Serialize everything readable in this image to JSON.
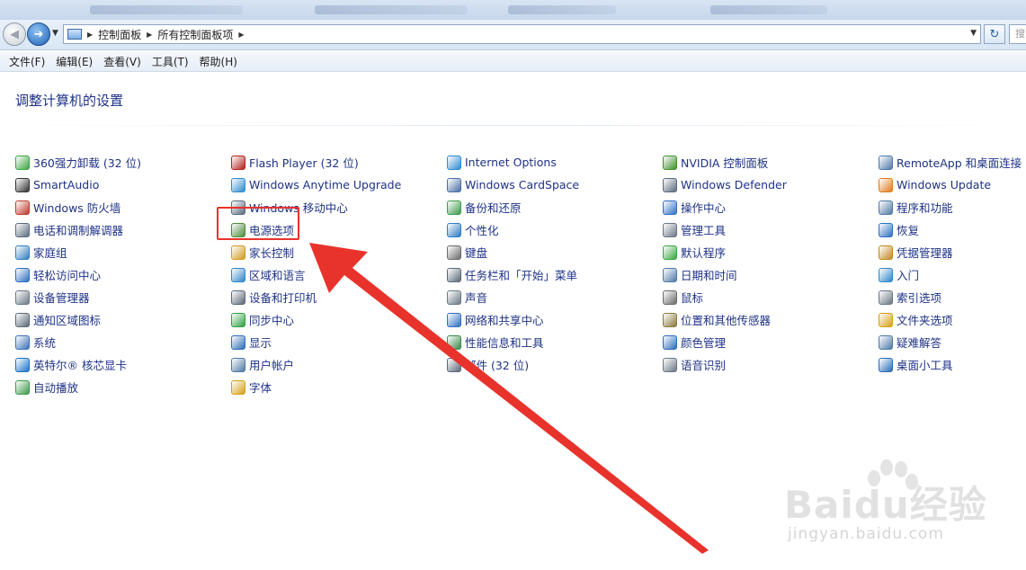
{
  "address_bar": {
    "breadcrumbs": [
      "控制面板",
      "所有控制面板项"
    ]
  },
  "search_placeholder": "搜",
  "menu": [
    "文件(F)",
    "编辑(E)",
    "查看(V)",
    "工具(T)",
    "帮助(H)"
  ],
  "page_title": "调整计算机的设置",
  "columns": [
    [
      {
        "label": "360强力卸载 (32 位)",
        "icon": "uninstall-icon",
        "color": "#3aa542"
      },
      {
        "label": "SmartAudio",
        "icon": "headphones-icon",
        "color": "#333333"
      },
      {
        "label": "Windows 防火墙",
        "icon": "firewall-icon",
        "color": "#c0392b"
      },
      {
        "label": "电话和调制解调器",
        "icon": "phone-modem-icon",
        "color": "#5a6b7d"
      },
      {
        "label": "家庭组",
        "icon": "homegroup-icon",
        "color": "#2f7fc1"
      },
      {
        "label": "轻松访问中心",
        "icon": "ease-of-access-icon",
        "color": "#2f6fc1"
      },
      {
        "label": "设备管理器",
        "icon": "device-manager-icon",
        "color": "#6b7785"
      },
      {
        "label": "通知区域图标",
        "icon": "notification-icons-icon",
        "color": "#5b6878"
      },
      {
        "label": "系统",
        "icon": "system-icon",
        "color": "#3b71b8"
      },
      {
        "label": "英特尔® 核芯显卡",
        "icon": "intel-graphics-icon",
        "color": "#1a73c7"
      },
      {
        "label": "自动播放",
        "icon": "autoplay-icon",
        "color": "#3a9a4a"
      }
    ],
    [
      {
        "label": "Flash Player (32 位)",
        "icon": "flash-player-icon",
        "color": "#b3221c"
      },
      {
        "label": "Windows Anytime Upgrade",
        "icon": "windows-upgrade-icon",
        "color": "#2c8ad0"
      },
      {
        "label": "Windows 移动中心",
        "icon": "mobility-center-icon",
        "color": "#5a6b7d"
      },
      {
        "label": "电源选项",
        "icon": "power-options-icon",
        "color": "#4a8a3a"
      },
      {
        "label": "家长控制",
        "icon": "parental-controls-icon",
        "color": "#d19a1f"
      },
      {
        "label": "区域和语言",
        "icon": "region-language-icon",
        "color": "#2f86c9"
      },
      {
        "label": "设备和打印机",
        "icon": "printer-icon",
        "color": "#5b6878"
      },
      {
        "label": "同步中心",
        "icon": "sync-center-icon",
        "color": "#2ea043"
      },
      {
        "label": "显示",
        "icon": "display-icon",
        "color": "#2b6cb8"
      },
      {
        "label": "用户帐户",
        "icon": "user-accounts-icon",
        "color": "#4f7aa8"
      },
      {
        "label": "字体",
        "icon": "fonts-icon",
        "color": "#d4a017"
      }
    ],
    [
      {
        "label": "Internet Options",
        "icon": "internet-options-icon",
        "color": "#2f8ad0"
      },
      {
        "label": "Windows CardSpace",
        "icon": "cardspace-icon",
        "color": "#4a6fa5"
      },
      {
        "label": "备份和还原",
        "icon": "backup-restore-icon",
        "color": "#3a9a4a"
      },
      {
        "label": "个性化",
        "icon": "personalization-icon",
        "color": "#2e7bc4"
      },
      {
        "label": "键盘",
        "icon": "keyboard-icon",
        "color": "#6b6b6b"
      },
      {
        "label": "任务栏和「开始」菜单",
        "icon": "taskbar-icon",
        "color": "#5b6878"
      },
      {
        "label": "声音",
        "icon": "sound-icon",
        "color": "#6b7785"
      },
      {
        "label": "网络和共享中心",
        "icon": "network-icon",
        "color": "#2f6fc1"
      },
      {
        "label": "性能信息和工具",
        "icon": "performance-icon",
        "color": "#3a8a4a"
      },
      {
        "label": "邮件 (32 位)",
        "icon": "mail-icon",
        "color": "#5b6878"
      }
    ],
    [
      {
        "label": "NVIDIA 控制面板",
        "icon": "nvidia-icon",
        "color": "#3f8f2f"
      },
      {
        "label": "Windows Defender",
        "icon": "defender-icon",
        "color": "#5a6b7d"
      },
      {
        "label": "操作中心",
        "icon": "action-center-flag-icon",
        "color": "#2f6fc1"
      },
      {
        "label": "管理工具",
        "icon": "admin-tools-icon",
        "color": "#6b7785"
      },
      {
        "label": "默认程序",
        "icon": "default-programs-icon",
        "color": "#3aa542"
      },
      {
        "label": "日期和时间",
        "icon": "clock-icon",
        "color": "#4f7aa8"
      },
      {
        "label": "鼠标",
        "icon": "mouse-icon",
        "color": "#6b6b6b"
      },
      {
        "label": "位置和其他传感器",
        "icon": "sensors-icon",
        "color": "#8a7a3a"
      },
      {
        "label": "颜色管理",
        "icon": "color-management-icon",
        "color": "#2b6cb8"
      },
      {
        "label": "语音识别",
        "icon": "microphone-icon",
        "color": "#6b7785"
      }
    ],
    [
      {
        "label": "RemoteApp 和桌面连接",
        "icon": "remoteapp-icon",
        "color": "#4f7aa8"
      },
      {
        "label": "Windows Update",
        "icon": "windows-update-icon",
        "color": "#e07a1f"
      },
      {
        "label": "程序和功能",
        "icon": "programs-features-icon",
        "color": "#4f7aa8"
      },
      {
        "label": "恢复",
        "icon": "recovery-icon",
        "color": "#2f6fc1"
      },
      {
        "label": "凭据管理器",
        "icon": "credential-manager-icon",
        "color": "#c08a1f"
      },
      {
        "label": "入门",
        "icon": "getting-started-icon",
        "color": "#2f86c9"
      },
      {
        "label": "索引选项",
        "icon": "indexing-icon",
        "color": "#6b7785"
      },
      {
        "label": "文件夹选项",
        "icon": "folder-options-icon",
        "color": "#d4a017"
      },
      {
        "label": "疑难解答",
        "icon": "troubleshooting-icon",
        "color": "#4f7aa8"
      },
      {
        "label": "桌面小工具",
        "icon": "gadgets-icon",
        "color": "#2b6cb8"
      }
    ]
  ],
  "highlighted_item": "电源选项",
  "annotation_color": "#e8332c",
  "watermark": {
    "main": "Baidu经验",
    "sub": "jingyan.baidu.com"
  }
}
